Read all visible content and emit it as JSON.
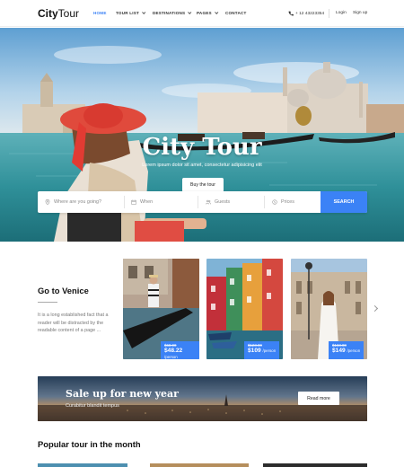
{
  "header": {
    "logo_bold": "City",
    "logo_rest": "Tour",
    "nav": [
      {
        "label": "HOME",
        "active": true
      },
      {
        "label": "TOUR LIST",
        "dropdown": true
      },
      {
        "label": "DESTINATIONS",
        "dropdown": true
      },
      {
        "label": "PAGES",
        "dropdown": true
      },
      {
        "label": "CONTACT"
      }
    ],
    "phone": "+ 12 43223354",
    "login": "Login",
    "signup": "Sign up"
  },
  "hero": {
    "title": "City Tour",
    "subtitle": "Lorem ipsum dolor sit amet, consectetur adipisicing elit",
    "button": "Buy the tour"
  },
  "search": {
    "where_placeholder": "Where are you going?",
    "when_placeholder": "When",
    "guests_placeholder": "Guests",
    "prices_placeholder": "Prices",
    "button": "SEARCH"
  },
  "venice": {
    "title": "Go to Venice",
    "text": "It is a long established fact that a reader will be distracted by the readable content of a page ...",
    "cards": [
      {
        "old_price": "$68.00",
        "new_price": "$48.22",
        "unit": "/person"
      },
      {
        "old_price": "$123.00",
        "new_price": "$109",
        "unit": "/person"
      },
      {
        "old_price": "$168.00",
        "new_price": "$149",
        "unit": "/person"
      }
    ]
  },
  "banner": {
    "title": "Sale up for new year",
    "subtitle": "Curabitur blandit tempus",
    "button": "Read more"
  },
  "popular": {
    "title": "Popular tour in the month"
  },
  "colors": {
    "accent": "#3b82f6"
  }
}
